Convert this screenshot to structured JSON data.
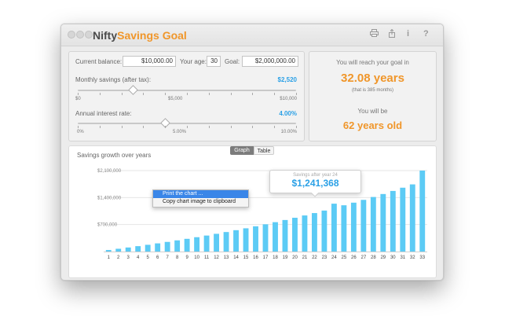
{
  "app": {
    "title_part1": "Nifty",
    "title_part2": "Savings Goal"
  },
  "toolbar": {
    "print_icon": "printer-icon",
    "share_icon": "share-icon",
    "info_label": "i",
    "help_label": "?"
  },
  "inputs": {
    "current_balance_label": "Current balance:",
    "current_balance_value": "$10,000.00",
    "age_label": "Your age:",
    "age_value": "30",
    "goal_label": "Goal:",
    "goal_value": "$2,000,000.00"
  },
  "monthly_savings": {
    "label": "Monthly savings (after tax):",
    "value": "$2,520",
    "level": 0.252,
    "ticks": [
      "$0",
      "$5,000",
      "$10,000"
    ]
  },
  "interest_rate": {
    "label": "Annual interest rate:",
    "value": "4.00%",
    "level": 0.4,
    "ticks": [
      "0%",
      "5.00%",
      "10.00%"
    ]
  },
  "result": {
    "reach_label": "You will reach your goal in",
    "years": "32.08 years",
    "months_note": "(that is 385 months)",
    "be_label": "You will be",
    "age": "62 years old"
  },
  "chart": {
    "title": "Savings growth over years",
    "tabs": [
      "Graph",
      "Table"
    ],
    "active_tab": "Graph"
  },
  "context_menu": {
    "items": [
      "Print the chart ...",
      "Copy chart image to clipboard"
    ]
  },
  "tooltip": {
    "label": "Savings after year 24",
    "value": "$1,241,368"
  },
  "colors": {
    "accent_orange": "#f0962a",
    "bar_blue": "#5ccbf5",
    "value_blue": "#2aa0e6"
  },
  "chart_data": {
    "type": "bar",
    "categories": [
      "1",
      "2",
      "3",
      "4",
      "5",
      "6",
      "7",
      "8",
      "9",
      "10",
      "11",
      "12",
      "13",
      "14",
      "15",
      "16",
      "17",
      "18",
      "19",
      "20",
      "21",
      "22",
      "23",
      "24",
      "25",
      "26",
      "27",
      "28",
      "29",
      "30",
      "31",
      "32",
      "33"
    ],
    "values": [
      40000,
      72000,
      105000,
      140000,
      175000,
      212000,
      250000,
      290000,
      330000,
      372000,
      415000,
      460000,
      506000,
      554000,
      603000,
      655000,
      707000,
      762000,
      818000,
      876000,
      936000,
      998000,
      1063000,
      1241368,
      1200000,
      1268000,
      1340000,
      1415000,
      1492000,
      1572000,
      1656000,
      1742000,
      2100000
    ],
    "yticks": [
      "$700,000",
      "$1,400,000",
      "$2,100,000"
    ],
    "ylim": [
      0,
      2100000
    ]
  }
}
